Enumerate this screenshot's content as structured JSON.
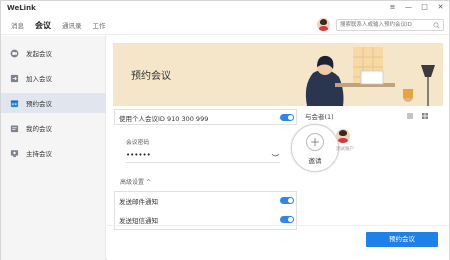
{
  "app": {
    "title": "WeLink"
  },
  "window_controls": {
    "settings": "≡",
    "minimize": "—",
    "maximize": "□",
    "close": "✕"
  },
  "nav": {
    "tabs": [
      {
        "label": "消息",
        "active": false
      },
      {
        "label": "会议",
        "active": true
      },
      {
        "label": "通讯录",
        "active": false
      },
      {
        "label": "工作",
        "active": false
      }
    ]
  },
  "search": {
    "placeholder": "搜索联系人或输入预约会议ID",
    "value": ""
  },
  "sidebar": {
    "items": [
      {
        "label": "发起会议",
        "icon": "start-meeting-icon",
        "active": false
      },
      {
        "label": "加入会议",
        "icon": "join-meeting-icon",
        "active": false
      },
      {
        "label": "预约会议",
        "icon": "calendar-icon",
        "active": true
      },
      {
        "label": "我的会议",
        "icon": "my-meetings-icon",
        "active": false
      },
      {
        "label": "主持会议",
        "icon": "host-meeting-icon",
        "active": false
      }
    ]
  },
  "main": {
    "title": "预约会议",
    "personal_meeting": {
      "label": "使用个人会议ID 910 300 999",
      "enabled": true
    },
    "password": {
      "label": "会议密码",
      "value": "••••••"
    },
    "advanced": {
      "label": "高级设置",
      "chevron": "^"
    },
    "notifications": [
      {
        "label": "发送邮件通知",
        "enabled": true
      },
      {
        "label": "发送短信通知",
        "enabled": true
      }
    ],
    "participants": {
      "label": "与会者(1)",
      "invite_label": "邀请",
      "invite_plus": "+",
      "member_name": "测试账户"
    },
    "submit_label": "预约会议"
  },
  "colors": {
    "accent": "#1f80ea",
    "banner_bg": "#f5e6c9",
    "sidebar_bg": "#f5f5f5",
    "sidebar_active": "#e1e6ee"
  }
}
